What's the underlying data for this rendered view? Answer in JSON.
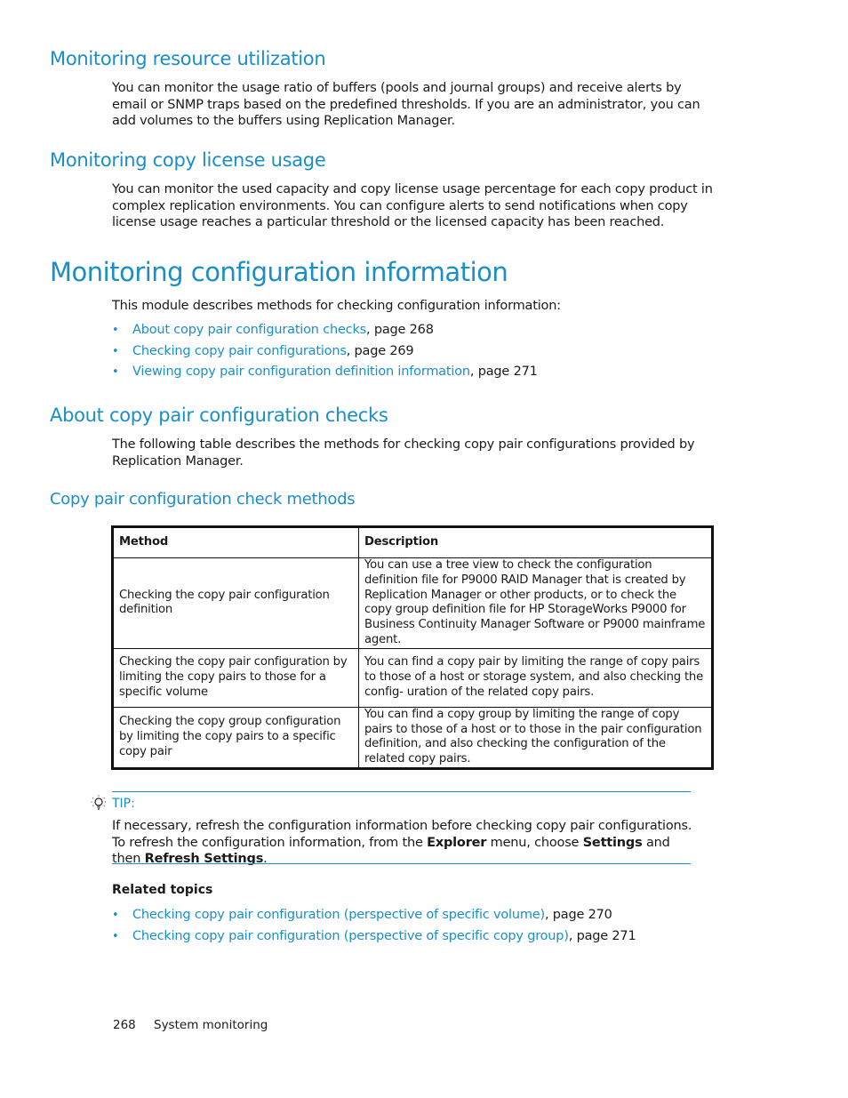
{
  "sections": {
    "resource": {
      "heading": "Monitoring resource utilization",
      "body": "You can monitor the usage ratio of buffers (pools and journal groups) and receive alerts by email or SNMP traps based on the predefined thresholds. If you are an administrator, you can add volumes to the buffers using Replication Manager."
    },
    "license": {
      "heading": "Monitoring copy license usage",
      "body": "You can monitor the used capacity and copy license usage percentage for each copy product in complex replication environments. You can configure alerts to send notifications when copy license usage reaches a particular threshold or the licensed capacity has been reached."
    },
    "config": {
      "heading": "Monitoring configuration information",
      "intro": "This module describes methods for checking configuration information:",
      "links": [
        {
          "bullet": "•",
          "text": "About copy pair configuration checks",
          "suffix": ", page 268"
        },
        {
          "bullet": "•",
          "text": "Checking copy pair configurations",
          "suffix": ", page 269"
        },
        {
          "bullet": "•",
          "text": "Viewing copy pair configuration definition information",
          "suffix": ", page 271"
        }
      ]
    },
    "about": {
      "heading": "About copy pair configuration checks",
      "body": "The following table describes the methods for checking copy pair configurations provided by Replication Manager."
    },
    "table": {
      "caption": "Copy pair configuration check methods",
      "headers": [
        "Method",
        "Description"
      ],
      "rows": [
        {
          "method": "Checking the copy pair configuration definition",
          "description": "You can use a tree view to check the configuration definition file for P9000 RAID Manager that is created by Replication Manager or other products, or to check the copy group definition file for HP StorageWorks P9000 for Business Continuity Manager Software or P9000 mainframe agent."
        },
        {
          "method": "Checking the copy pair configuration by limiting the copy pairs to those for a specific volume",
          "description": "You can find a copy pair by limiting the range of copy pairs to those of a host or storage system, and also checking the config- uration of the related copy pairs."
        },
        {
          "method": "Checking the copy group configuration by limiting the copy pairs to a specific copy pair",
          "description": "You can find a copy group by limiting the range of copy pairs to those of a host or to those in the pair configuration definition, and also checking the configuration of the related copy pairs."
        }
      ]
    },
    "tip": {
      "icon": "lightbulb-icon",
      "label": "TIP:",
      "text_1": "If necessary, refresh the configuration information before checking copy pair configurations. To refresh the configuration information, from the ",
      "bold_1": "Explorer",
      "text_2": " menu, choose ",
      "bold_2": "Settings",
      "text_3": " and then ",
      "bold_3": "Refresh Settings",
      "text_4": "."
    },
    "related": {
      "heading": "Related topics",
      "links": [
        {
          "bullet": "•",
          "text": "Checking copy pair configuration (perspective of specific volume)",
          "suffix": ", page 270"
        },
        {
          "bullet": "•",
          "text": "Checking copy pair configuration (perspective of specific copy group)",
          "suffix": ", page 271"
        }
      ]
    }
  },
  "footer": {
    "page_number": "268",
    "chapter": "System monitoring"
  },
  "colors": {
    "heading": "#1a8ec9",
    "link": "#1a8ec9",
    "text": "#1a1a1a"
  }
}
